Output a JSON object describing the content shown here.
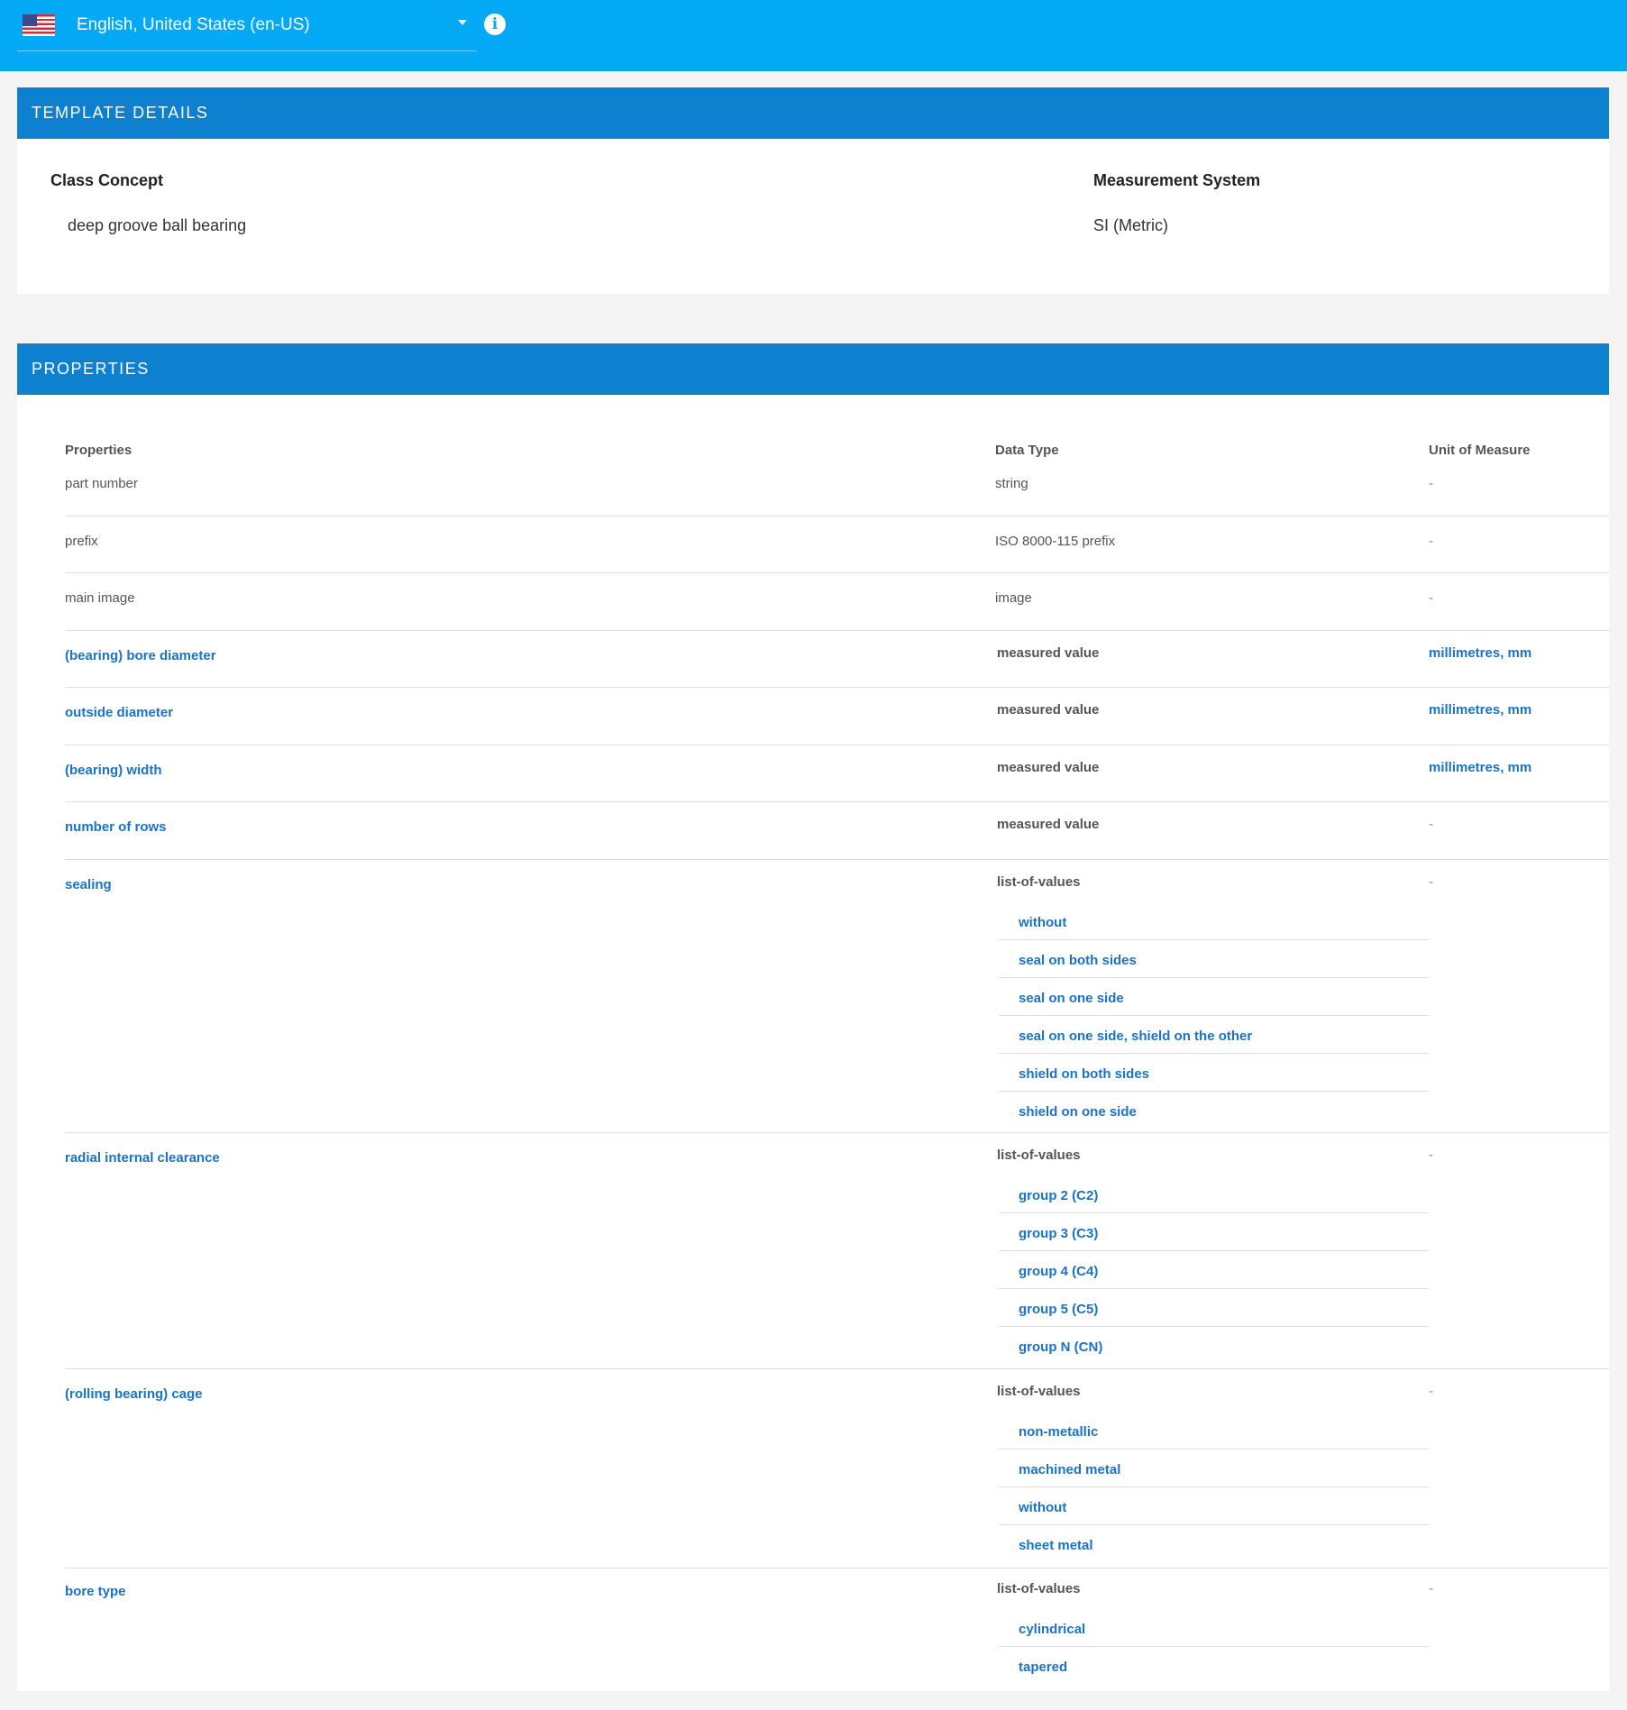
{
  "header": {
    "language": "English, United States (en-US)"
  },
  "template_details": {
    "title": "TEMPLATE DETAILS",
    "class_concept_label": "Class Concept",
    "class_concept_value": "deep groove ball bearing",
    "measurement_system_label": "Measurement System",
    "measurement_system_value": "SI (Metric)"
  },
  "properties": {
    "title": "PROPERTIES",
    "columns": [
      "Properties",
      "Data Type",
      "Unit of Measure"
    ],
    "rows": [
      {
        "name": "part number",
        "data_type": "string",
        "unit": "-"
      },
      {
        "name": "prefix",
        "data_type": "ISO 8000-115 prefix",
        "unit": "-"
      },
      {
        "name": "main image",
        "data_type": "image",
        "unit": "-"
      },
      {
        "name": "(bearing) bore diameter",
        "data_type": "measured value",
        "unit": "millimetres, mm"
      },
      {
        "name": "outside diameter",
        "data_type": "measured value",
        "unit": "millimetres, mm"
      },
      {
        "name": "(bearing) width",
        "data_type": "measured value",
        "unit": "millimetres, mm"
      },
      {
        "name": "number of rows",
        "data_type": "measured value",
        "unit": "-"
      },
      {
        "name": "sealing",
        "data_type": "list-of-values",
        "unit": "-",
        "values": [
          "without",
          "seal on both sides",
          "seal on one side",
          "seal on one side, shield on the other",
          "shield on both sides",
          "shield on one side"
        ]
      },
      {
        "name": "radial internal clearance",
        "data_type": "list-of-values",
        "unit": "-",
        "values": [
          "group 2 (C2)",
          "group 3 (C3)",
          "group 4 (C4)",
          "group 5 (C5)",
          "group N (CN)"
        ]
      },
      {
        "name": "(rolling bearing) cage",
        "data_type": "list-of-values",
        "unit": "-",
        "values": [
          "non-metallic",
          "machined metal",
          "without",
          "sheet metal"
        ]
      },
      {
        "name": "bore type",
        "data_type": "list-of-values",
        "unit": "-",
        "values": [
          "cylindrical",
          "tapered"
        ]
      }
    ]
  },
  "colors": {
    "topbar": "#03a9f4",
    "section_header": "#0d80d0",
    "link": "#1a73c7"
  },
  "icons": [
    "us-flag-icon",
    "chevron-down-icon",
    "info-icon"
  ]
}
